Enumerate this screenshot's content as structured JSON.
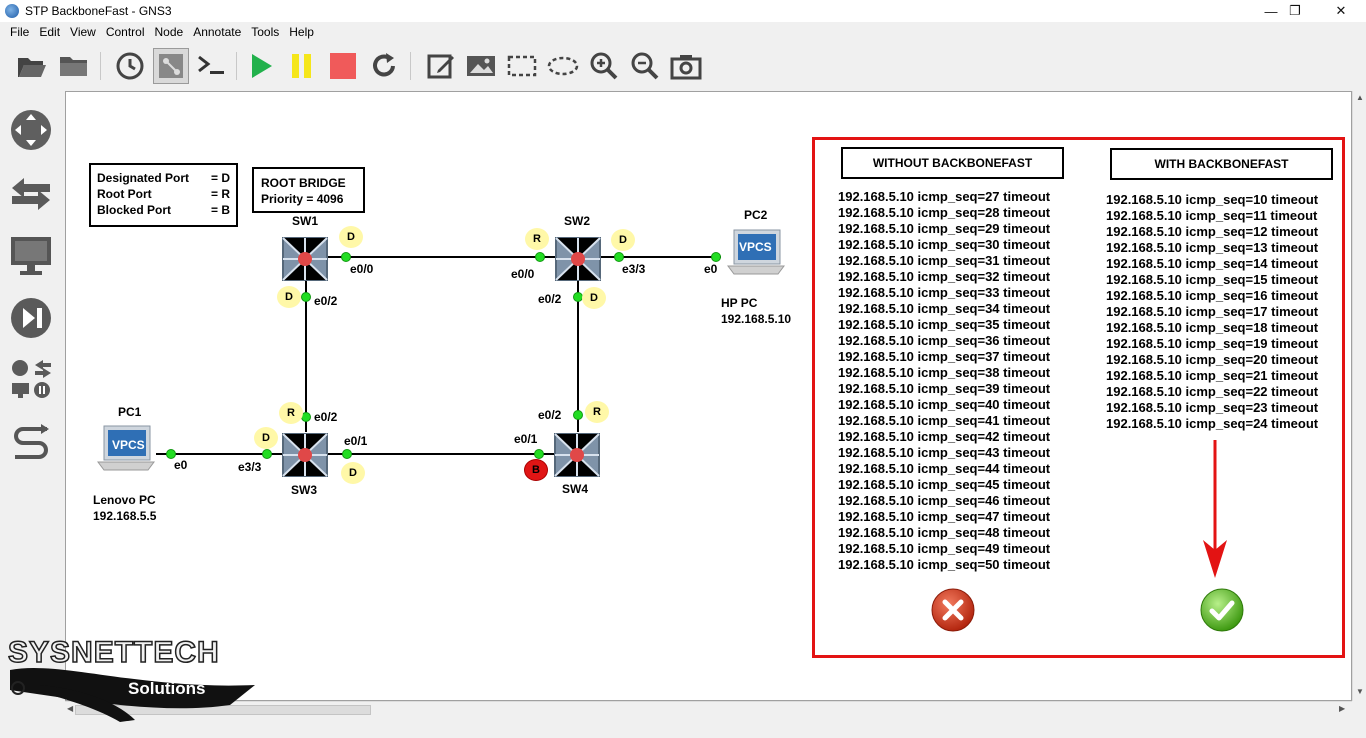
{
  "window": {
    "title": "STP BackboneFast - GNS3",
    "minimize": "—",
    "maximize": "❐",
    "close": "✕"
  },
  "menu": [
    "File",
    "Edit",
    "View",
    "Control",
    "Node",
    "Annotate",
    "Tools",
    "Help"
  ],
  "legend": {
    "designated": {
      "label": "Designated Port",
      "value": "= D"
    },
    "root": {
      "label": "Root Port",
      "value": "= R"
    },
    "blocked": {
      "label": "Blocked Port",
      "value": "= B"
    }
  },
  "root_bridge": {
    "line1": "ROOT BRIDGE",
    "line2": "Priority = 4096"
  },
  "nodes": {
    "sw1": "SW1",
    "sw2": "SW2",
    "sw3": "SW3",
    "sw4": "SW4",
    "pc1": "PC1",
    "pc2": "PC2",
    "pc1_desc": "Lenovo PC",
    "pc1_ip": "192.168.5.5",
    "pc2_desc": "HP PC",
    "pc2_ip": "192.168.5.10",
    "vpcs": "VPCS"
  },
  "ports": {
    "sw1_e00": "e0/0",
    "sw1_e02": "e0/2",
    "sw2_e00": "e0/0",
    "sw2_e33": "e3/3",
    "sw2_e02": "e0/2",
    "pc2_e0": "e0",
    "sw3_e02": "e0/2",
    "sw3_e01": "e0/1",
    "sw3_e33": "e3/3",
    "pc1_e0": "e0",
    "sw4_e02": "e0/2",
    "sw4_e01": "e0/1"
  },
  "badges": {
    "d": "D",
    "r": "R",
    "b": "B"
  },
  "results": {
    "without": {
      "heading": "WITHOUT BACKBONEFAST",
      "lines": [
        "192.168.5.10 icmp_seq=27 timeout",
        "192.168.5.10 icmp_seq=28 timeout",
        "192.168.5.10 icmp_seq=29 timeout",
        "192.168.5.10 icmp_seq=30 timeout",
        "192.168.5.10 icmp_seq=31 timeout",
        "192.168.5.10 icmp_seq=32 timeout",
        "192.168.5.10 icmp_seq=33 timeout",
        "192.168.5.10 icmp_seq=34 timeout",
        "192.168.5.10 icmp_seq=35 timeout",
        "192.168.5.10 icmp_seq=36 timeout",
        "192.168.5.10 icmp_seq=37 timeout",
        "192.168.5.10 icmp_seq=38 timeout",
        "192.168.5.10 icmp_seq=39 timeout",
        "192.168.5.10 icmp_seq=40 timeout",
        "192.168.5.10 icmp_seq=41 timeout",
        "192.168.5.10 icmp_seq=42 timeout",
        "192.168.5.10 icmp_seq=43 timeout",
        "192.168.5.10 icmp_seq=44 timeout",
        "192.168.5.10 icmp_seq=45 timeout",
        "192.168.5.10 icmp_seq=46 timeout",
        "192.168.5.10 icmp_seq=47 timeout",
        "192.168.5.10 icmp_seq=48 timeout",
        "192.168.5.10 icmp_seq=49 timeout",
        "192.168.5.10 icmp_seq=50 timeout"
      ]
    },
    "with": {
      "heading": "WITH BACKBONEFAST",
      "lines": [
        "192.168.5.10 icmp_seq=10 timeout",
        "192.168.5.10 icmp_seq=11 timeout",
        "192.168.5.10 icmp_seq=12 timeout",
        "192.168.5.10 icmp_seq=13 timeout",
        "192.168.5.10 icmp_seq=14 timeout",
        "192.168.5.10 icmp_seq=15 timeout",
        "192.168.5.10 icmp_seq=16 timeout",
        "192.168.5.10 icmp_seq=17 timeout",
        "192.168.5.10 icmp_seq=18 timeout",
        "192.168.5.10 icmp_seq=19 timeout",
        "192.168.5.10 icmp_seq=20 timeout",
        "192.168.5.10 icmp_seq=21 timeout",
        "192.168.5.10 icmp_seq=22 timeout",
        "192.168.5.10 icmp_seq=23 timeout",
        "192.168.5.10 icmp_seq=24 timeout"
      ]
    }
  },
  "watermark": {
    "brand": "SYSNETTECH",
    "sub": "Solutions"
  },
  "colors": {
    "accent_red": "#e31313",
    "port_green": "#22dd22",
    "badge_yellow": "#fff8a8"
  }
}
